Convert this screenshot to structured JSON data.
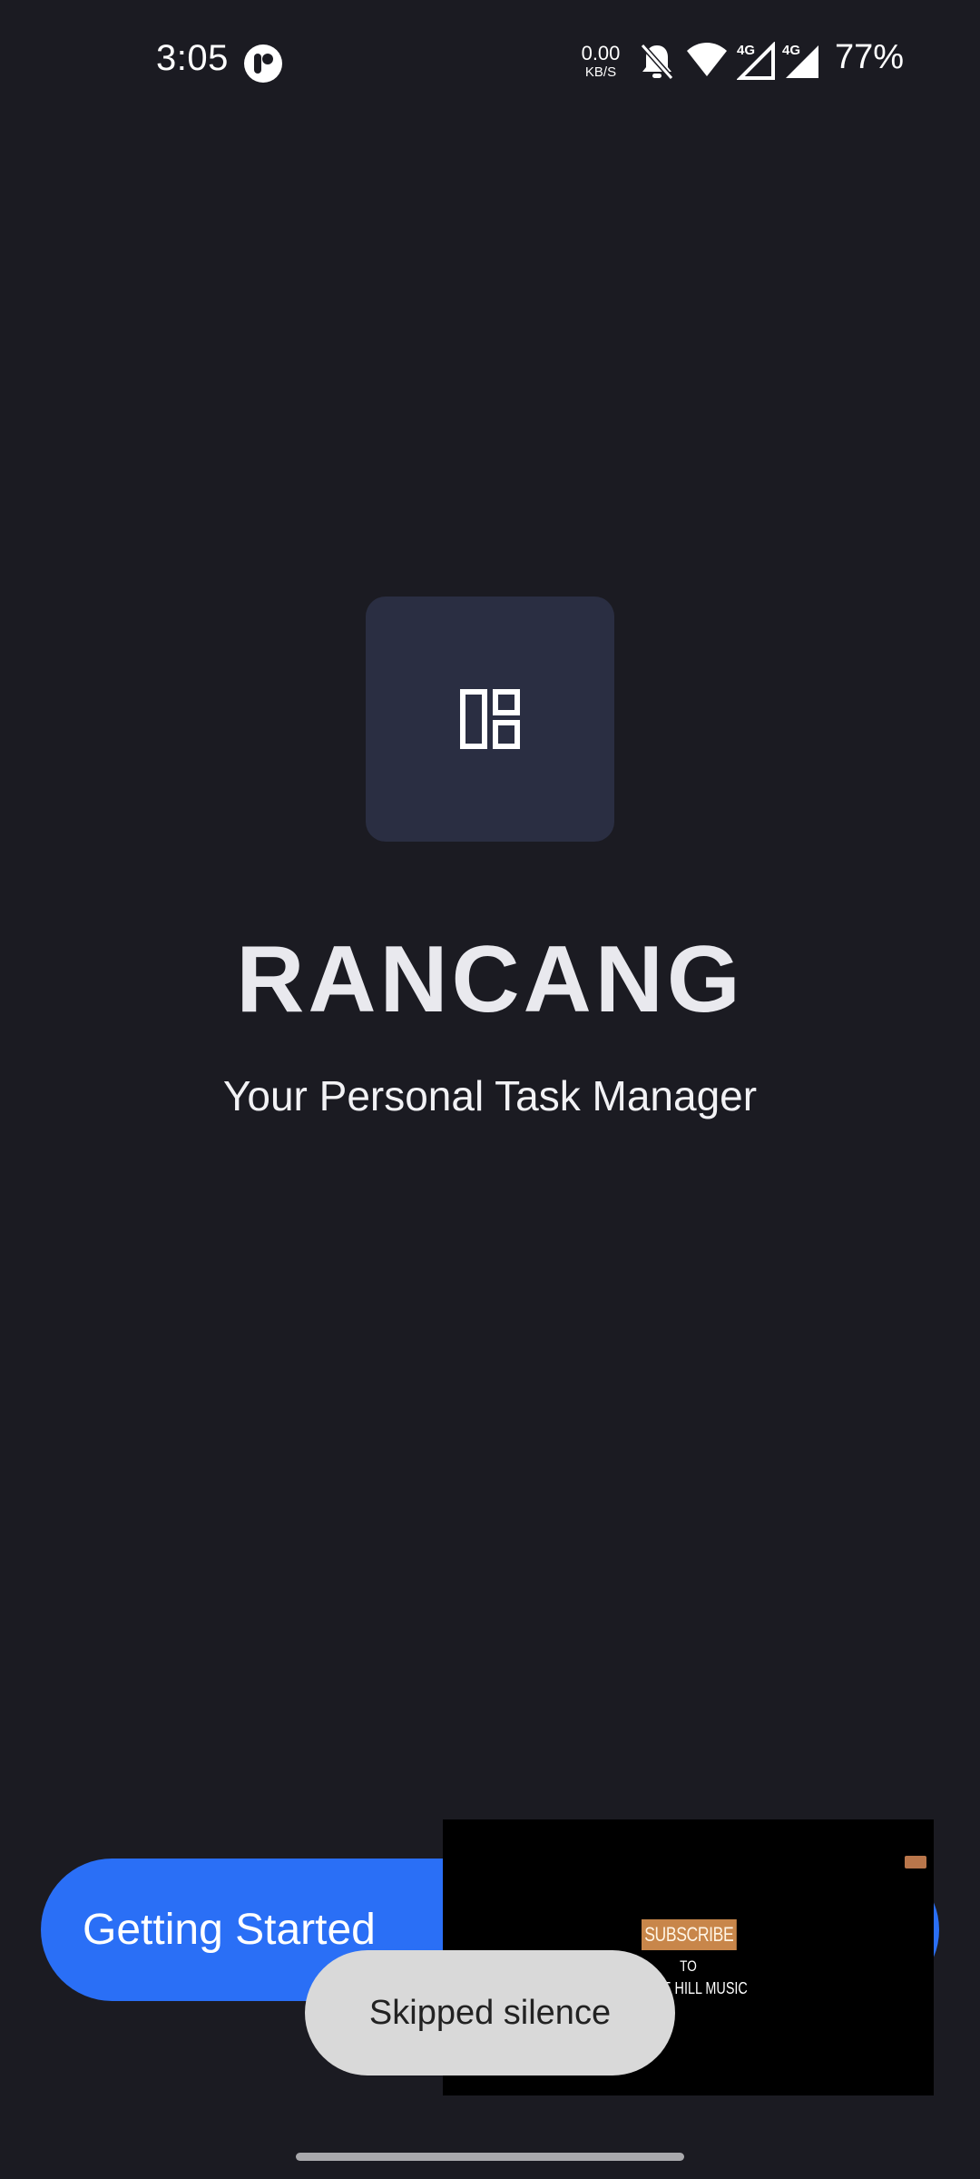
{
  "status_bar": {
    "time": "3:05",
    "net_speed": "0.00",
    "net_unit": "KB/S",
    "network_1": "4G",
    "network_2": "4G",
    "battery": "77%"
  },
  "app": {
    "logo_icon": "dashboard-icon",
    "title": "RANCANG",
    "subtitle": "Your Personal Task Manager"
  },
  "actions": {
    "start_label": "Getting Started"
  },
  "pip": {
    "subscribe": "SUBSCRIBE",
    "to": "TO",
    "channel": "WHITE HILL MUSIC"
  },
  "toast": {
    "message": "Skipped silence"
  },
  "colors": {
    "background": "#1b1b22",
    "accent": "#2a6ff6",
    "tile": "#2a2e42"
  }
}
